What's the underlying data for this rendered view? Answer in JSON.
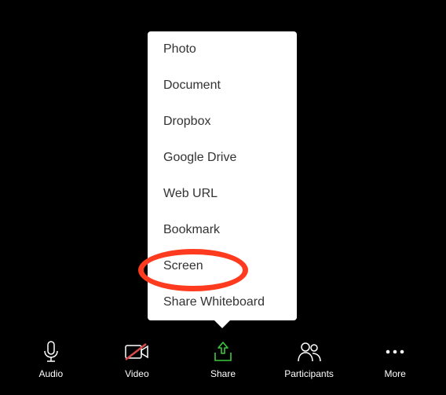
{
  "share_menu": {
    "items": [
      {
        "label": "Photo"
      },
      {
        "label": "Document"
      },
      {
        "label": "Dropbox"
      },
      {
        "label": "Google Drive"
      },
      {
        "label": "Web URL"
      },
      {
        "label": "Bookmark"
      },
      {
        "label": "Screen"
      },
      {
        "label": "Share Whiteboard"
      }
    ]
  },
  "toolbar": {
    "audio_label": "Audio",
    "video_label": "Video",
    "share_label": "Share",
    "participants_label": "Participants",
    "more_label": "More"
  },
  "colors": {
    "accent": "#3cc93c",
    "highlight": "#ff3b1f",
    "video_off": "#d94a4a"
  }
}
